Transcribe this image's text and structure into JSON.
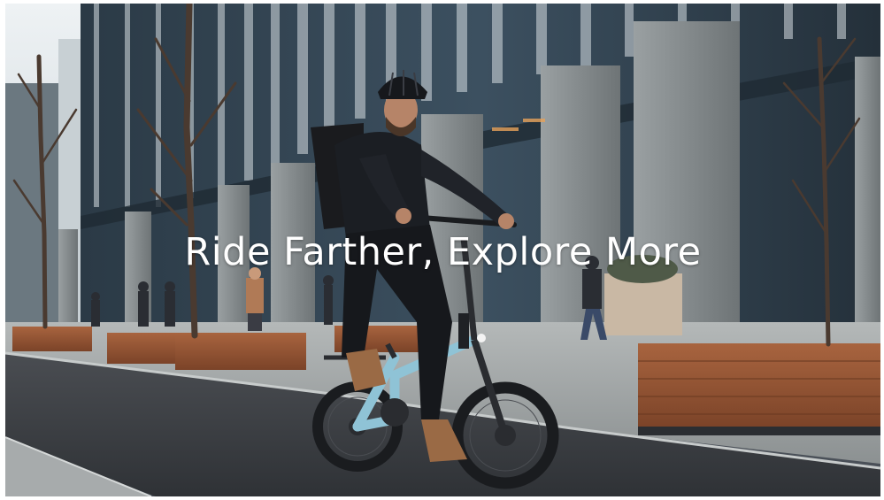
{
  "hero": {
    "headline": "Ride Farther, Explore More"
  },
  "palette": {
    "sky": "#dfe6ea",
    "glass": "#2f3e4a",
    "stone": "#8f9597",
    "road": "#3b3e43",
    "pavement": "#9ea3a4",
    "planter_wood": "#9a5a3a",
    "bike_frame": "#8fc3d6",
    "jacket": "#1b1e23",
    "headline_text": "#ffffff"
  },
  "image": {
    "subject": "cyclist-on-folding-ebike",
    "icons": [
      "helmet-icon",
      "bicycle-icon"
    ]
  }
}
